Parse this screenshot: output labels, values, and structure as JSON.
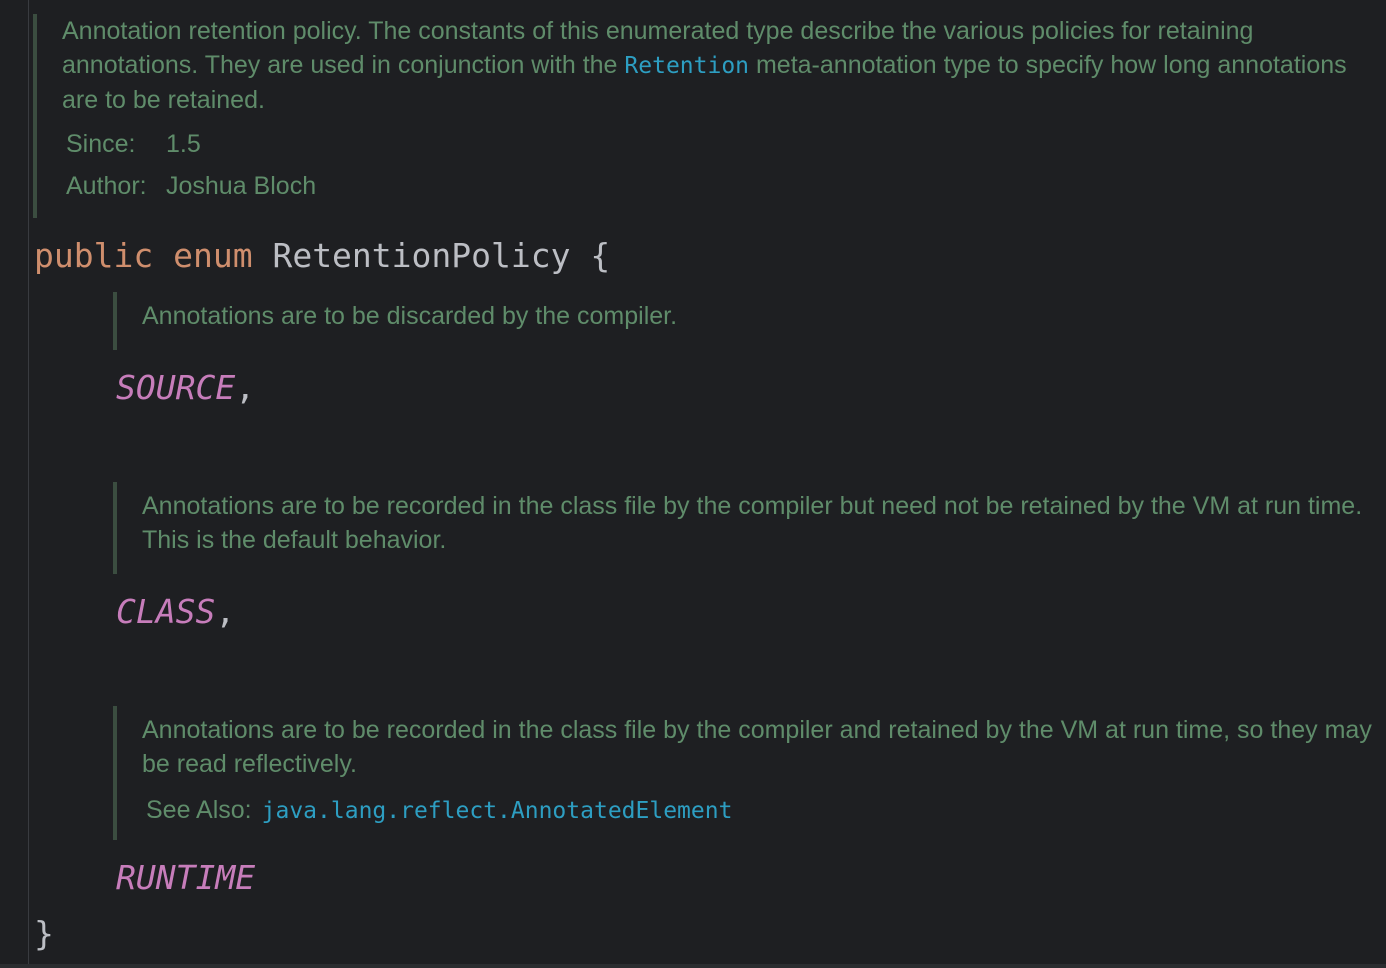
{
  "class_doc": {
    "text_before_link": "Annotation retention policy. The constants of this enumerated type describe the various policies for retaining annotations. They are used in conjunction with the ",
    "link": "Retention",
    "text_after_link": " meta-annotation type to specify how long annotations are to be retained.",
    "since_label": "Since:",
    "since_value": "1.5",
    "author_label": "Author:",
    "author_value": "Joshua Bloch"
  },
  "declaration": {
    "modifier": "public",
    "keyword": "enum",
    "name": "RetentionPolicy",
    "open_brace": "{",
    "close_brace": "}"
  },
  "constants": [
    {
      "doc": "Annotations are to be discarded by the compiler.",
      "name": "SOURCE",
      "separator": ","
    },
    {
      "doc": "Annotations are to be recorded in the class file by the compiler but need not be retained by the VM at run time. This is the default behavior.",
      "name": "CLASS",
      "separator": ","
    },
    {
      "doc": "Annotations are to be recorded in the class file by the compiler and retained by the VM at run time, so they may be read reflectively.",
      "see_also_label": "See Also:",
      "see_also_link": "java.lang.reflect.AnnotatedElement",
      "name": "RUNTIME",
      "separator": ""
    }
  ],
  "colors": {
    "background": "#1e1f22",
    "doc_text": "#5f8c6a",
    "doc_border": "#3b4d40",
    "keyword": "#cf8e6d",
    "identifier": "#bcbec4",
    "enum_constant": "#c77dbb",
    "link": "#2d9ec2"
  }
}
